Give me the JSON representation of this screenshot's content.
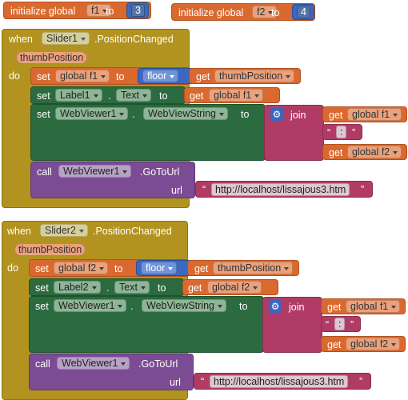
{
  "globals": [
    {
      "keyword": "initialize global",
      "name": "f1",
      "to": "to",
      "value": "3"
    },
    {
      "keyword": "initialize global",
      "name": "f2",
      "to": "to",
      "value": "4"
    }
  ],
  "handlers": [
    {
      "when": "when",
      "component": "Slider1",
      "event": ".PositionChanged",
      "param": "thumbPosition",
      "do": "do",
      "set_global": {
        "set": "set",
        "var": "global f1",
        "to": "to",
        "op": "floor",
        "get": "get",
        "arg": "thumbPosition"
      },
      "set_label": {
        "set": "set",
        "component": "Label1",
        "dot": ".",
        "prop": "Text",
        "to": "to",
        "get": "get",
        "var": "global f1"
      },
      "set_web": {
        "set": "set",
        "component": "WebViewer1",
        "dot": ".",
        "prop": "WebViewString",
        "to": "to",
        "join": "join",
        "get1": "get",
        "var1": "global f1",
        "quote_open": "“",
        "sep": ":",
        "quote_close": "”",
        "get2": "get",
        "var2": "global f2"
      },
      "call": {
        "call": "call",
        "component": "WebViewer1",
        "method": ".GoToUrl",
        "arg_label": "url",
        "quote_open": "“",
        "url": "http://localhost/lissajous3.htm",
        "quote_close": "”"
      }
    },
    {
      "when": "when",
      "component": "Slider2",
      "event": ".PositionChanged",
      "param": "thumbPosition",
      "do": "do",
      "set_global": {
        "set": "set",
        "var": "global f2",
        "to": "to",
        "op": "floor",
        "get": "get",
        "arg": "thumbPosition"
      },
      "set_label": {
        "set": "set",
        "component": "Label2",
        "dot": ".",
        "prop": "Text",
        "to": "to",
        "get": "get",
        "var": "global f2"
      },
      "set_web": {
        "set": "set",
        "component": "WebViewer1",
        "dot": ".",
        "prop": "WebViewString",
        "to": "to",
        "join": "join",
        "get1": "get",
        "var1": "global f1",
        "quote_open": "“",
        "sep": ":",
        "quote_close": "”",
        "get2": "get",
        "var2": "global f2"
      },
      "call": {
        "call": "call",
        "component": "WebViewer1",
        "method": ".GoToUrl",
        "arg_label": "url",
        "quote_open": "“",
        "url": "http://localhost/lissajous3.htm",
        "quote_close": "”"
      }
    }
  ]
}
